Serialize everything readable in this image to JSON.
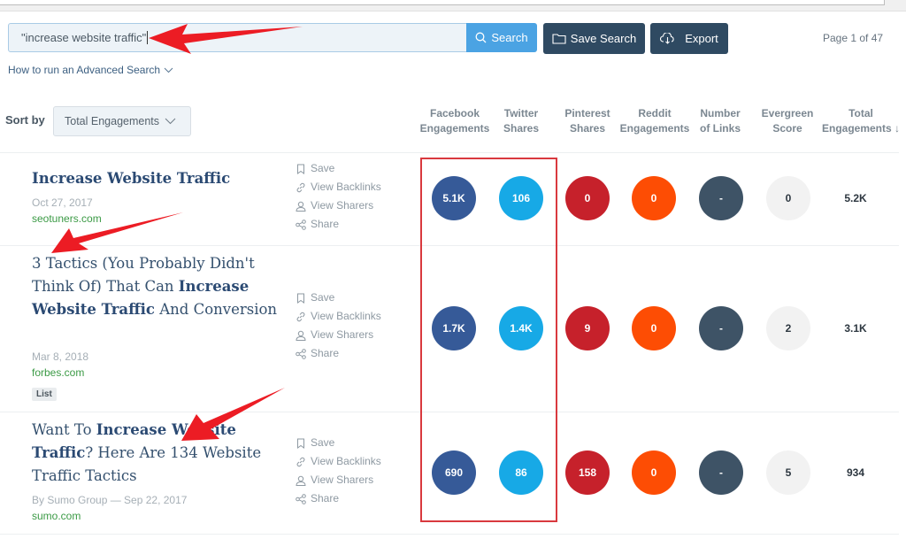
{
  "search": {
    "query": "\"increase website traffic\"",
    "search_label": "Search",
    "save_search_label": "Save Search",
    "export_label": "Export",
    "page_info": "Page 1 of 47",
    "advanced_link": "How to run an Advanced Search"
  },
  "sort": {
    "label": "Sort by",
    "selected": "Total Engagements"
  },
  "columns": [
    {
      "line1": "Facebook",
      "line2": "Engagements"
    },
    {
      "line1": "Twitter",
      "line2": "Shares"
    },
    {
      "line1": "Pinterest",
      "line2": "Shares"
    },
    {
      "line1": "Reddit",
      "line2": "Engagements"
    },
    {
      "line1": "Number",
      "line2": "of Links"
    },
    {
      "line1": "Evergreen",
      "line2": "Score"
    },
    {
      "line1": "Total",
      "line2": "Engagements ↓"
    }
  ],
  "actions": {
    "save": "Save",
    "backlinks": "View Backlinks",
    "sharers": "View Sharers",
    "share": "Share"
  },
  "colors": {
    "facebook": "#365a98",
    "twitter": "#17a9e6",
    "pinterest": "#c6212b",
    "reddit": "#fd4d04",
    "links": "#3e5366",
    "evergreen": "#f2f2f2",
    "highlight": "#d9393e"
  },
  "results": [
    {
      "title_parts": [
        {
          "t": "Increase Website Traffic",
          "b": true
        }
      ],
      "meta": "Oct 27, 2017",
      "domain": "seotuners.com",
      "tag": null,
      "facebook": "5.1K",
      "twitter": "106",
      "pinterest": "0",
      "reddit": "0",
      "links": "-",
      "evergreen": "0",
      "total": "5.2K"
    },
    {
      "title_parts": [
        {
          "t": "3 Tactics (You Probably Didn't Think Of) That Can ",
          "b": false
        },
        {
          "t": "Increase Website Traffic",
          "b": true
        },
        {
          "t": " And Conversion",
          "b": false
        }
      ],
      "meta": "Mar 8, 2018",
      "domain": "forbes.com",
      "tag": "List",
      "facebook": "1.7K",
      "twitter": "1.4K",
      "pinterest": "9",
      "reddit": "0",
      "links": "-",
      "evergreen": "2",
      "total": "3.1K"
    },
    {
      "title_parts": [
        {
          "t": "Want To ",
          "b": false
        },
        {
          "t": "Increase Website Traffic",
          "b": true
        },
        {
          "t": "? Here Are 134 Website Traffic Tactics",
          "b": false
        }
      ],
      "meta": "By Sumo Group — Sep 22, 2017",
      "domain": "sumo.com",
      "tag": null,
      "facebook": "690",
      "twitter": "86",
      "pinterest": "158",
      "reddit": "0",
      "links": "-",
      "evergreen": "5",
      "total": "934"
    }
  ]
}
